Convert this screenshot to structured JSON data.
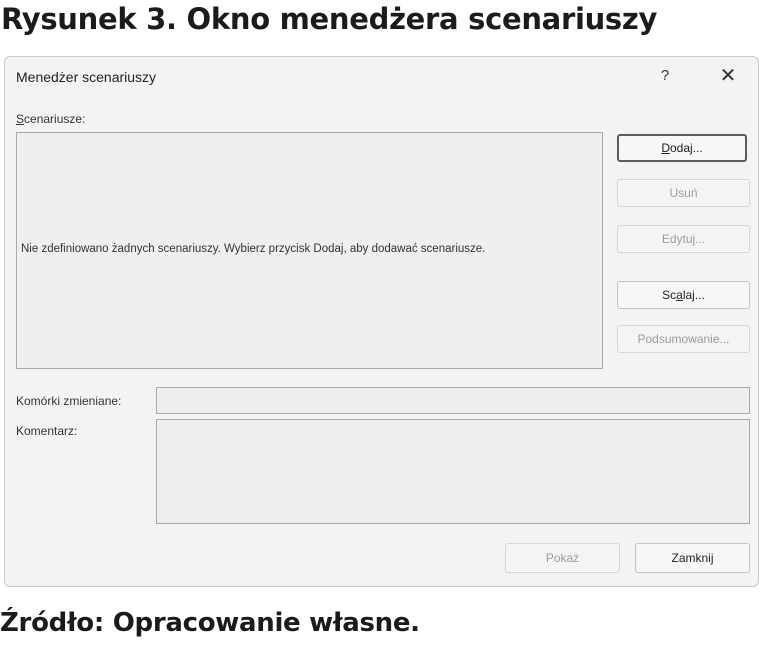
{
  "caption": {
    "title": "Rysunek 3. Okno menedżera scenariuszy",
    "source": "Źródło: Opracowanie własne."
  },
  "dialog": {
    "title": "Menedżer scenariuszy",
    "help_label": "?",
    "close_label": "✕",
    "scenarios_label_accel": "S",
    "scenarios_label_rest": "cenariusze:",
    "empty_message": "Nie zdefiniowano żadnych scenariuszy. Wybierz przycisk Dodaj, aby dodawać scenariusze.",
    "buttons": {
      "add_accel": "D",
      "add_rest": "odaj...",
      "delete": "Usuń",
      "edit": "Edytuj...",
      "merge_pre": "Sc",
      "merge_accel": "a",
      "merge_rest": "laj...",
      "summary": "Podsumowanie...",
      "show": "Pokaż",
      "close": "Zamknij"
    },
    "changing_cells_label": "Komórki zmieniane:",
    "changing_cells_value": "",
    "comment_label": "Komentarz:",
    "comment_value": ""
  }
}
